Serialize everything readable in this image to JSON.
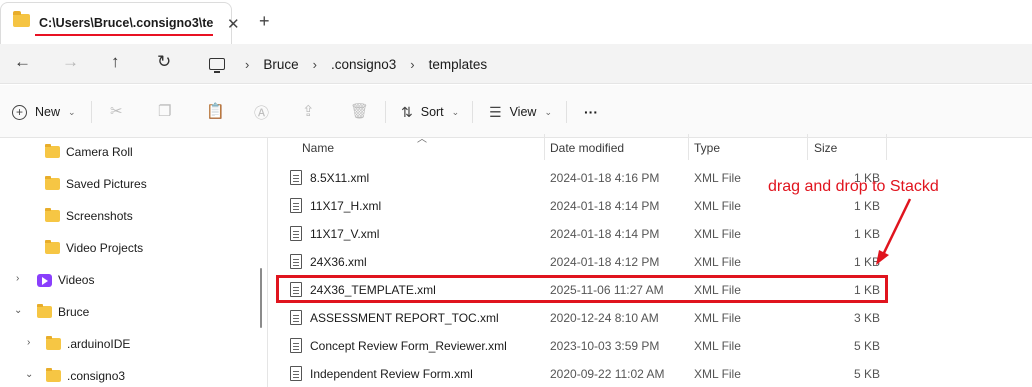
{
  "window": {
    "tab_title": "C:\\Users\\Bruce\\.consigno3\\te",
    "tab_close_glyph": "✕",
    "new_tab_glyph": "+"
  },
  "nav": {
    "back_glyph": "←",
    "forward_glyph": "→",
    "up_glyph": "↑",
    "refresh_glyph": "↻",
    "breadcrumb": [
      "Bruce",
      ".consigno3",
      "templates"
    ]
  },
  "toolbar": {
    "new_label": "New",
    "sort_label": "Sort",
    "view_label": "View",
    "more_label": "···",
    "icons": [
      "cut-icon",
      "copy-icon",
      "paste-icon",
      "rename-icon",
      "share-icon",
      "delete-icon"
    ]
  },
  "sidebar": {
    "items": [
      {
        "label": "Camera Roll",
        "icon": "folder-icon"
      },
      {
        "label": "Saved Pictures",
        "icon": "folder-icon"
      },
      {
        "label": "Screenshots",
        "icon": "folder-icon"
      },
      {
        "label": "Video Projects",
        "icon": "folder-icon"
      },
      {
        "label": "Videos",
        "icon": "videos-icon",
        "expand": "collapsed"
      },
      {
        "label": "Bruce",
        "icon": "folder-icon",
        "expand": "expanded"
      },
      {
        "label": ".arduinoIDE",
        "icon": "folder-icon",
        "expand": "collapsed"
      },
      {
        "label": ".consigno3",
        "icon": "folder-icon",
        "expand": "expanded"
      }
    ]
  },
  "filelist": {
    "columns": {
      "name": "Name",
      "date": "Date modified",
      "type": "Type",
      "size": "Size"
    },
    "rows": [
      {
        "name": "8.5X11.xml",
        "date": "2024-01-18 4:16 PM",
        "type": "XML File",
        "size": "1 KB"
      },
      {
        "name": "11X17_H.xml",
        "date": "2024-01-18 4:14 PM",
        "type": "XML File",
        "size": "1 KB"
      },
      {
        "name": "11X17_V.xml",
        "date": "2024-01-18 4:14 PM",
        "type": "XML File",
        "size": "1 KB"
      },
      {
        "name": "24X36.xml",
        "date": "2024-01-18 4:12 PM",
        "type": "XML File",
        "size": "1 KB"
      },
      {
        "name": "24X36_TEMPLATE.xml",
        "date": "2025-11-06 11:27 AM",
        "type": "XML File",
        "size": "1 KB"
      },
      {
        "name": "ASSESSMENT REPORT_TOC.xml",
        "date": "2020-12-24 8:10 AM",
        "type": "XML File",
        "size": "3 KB"
      },
      {
        "name": "Concept Review Form_Reviewer.xml",
        "date": "2023-10-03 3:59 PM",
        "type": "XML File",
        "size": "5 KB"
      },
      {
        "name": "Independent Review Form.xml",
        "date": "2020-09-22 11:02 AM",
        "type": "XML File",
        "size": "5 KB"
      }
    ]
  },
  "annotation": {
    "text": "drag and drop to Stackd",
    "color": "#e0141e"
  }
}
